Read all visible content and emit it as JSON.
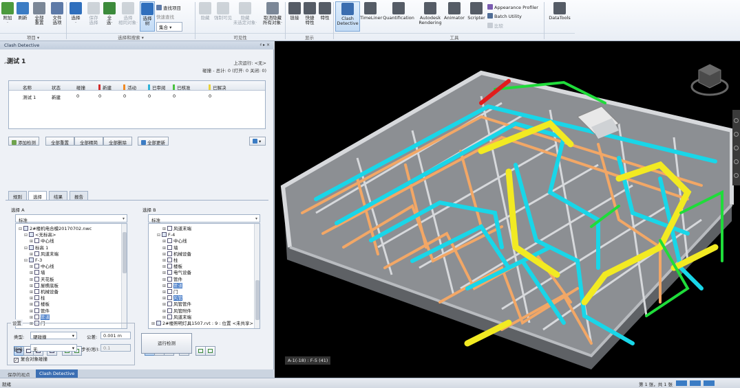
{
  "ribbon": {
    "buttons": [
      {
        "label": "附加\n·",
        "icon": "append-icon",
        "color": "#4c9a3e"
      },
      {
        "label": "刷新",
        "icon": "refresh-icon",
        "color": "#3b7cc4"
      },
      {
        "label": "全部\n重置",
        "icon": "reset-all-icon",
        "color": "#7b8797"
      },
      {
        "label": "文件\n选项",
        "icon": "file-options-icon",
        "color": "#5d7aa8"
      },
      {
        "label": "选择\n·",
        "icon": "select-cursor-icon",
        "color": "#2f6fbd"
      },
      {
        "label": "保存\n选择",
        "icon": "save-selection-icon",
        "color": "#9aa3ad"
      },
      {
        "label": "全\n选·",
        "icon": "select-all-icon",
        "color": "#3b8a3b"
      },
      {
        "label": "选择\n相同对象·",
        "icon": "select-same-icon",
        "color": "#9aa3ad"
      },
      {
        "label": "选择\n树",
        "icon": "selection-tree-icon",
        "color": "#2f6fbd"
      },
      {
        "label": "隐藏",
        "icon": "hide-icon",
        "color": "#9aa3ad"
      },
      {
        "label": "强制可见",
        "icon": "require-icon",
        "color": "#9aa3ad"
      },
      {
        "label": "隐藏\n未选定对象·",
        "icon": "hide-unselected-icon",
        "color": "#9aa3ad"
      },
      {
        "label": "取消隐藏\n所有对象·",
        "icon": "unhide-all-icon",
        "color": "#7b8797"
      },
      {
        "label": "链接",
        "icon": "links-icon",
        "color": "#555c66"
      },
      {
        "label": "快捷\n特性",
        "icon": "quick-properties-icon",
        "color": "#555c66"
      },
      {
        "label": "特性",
        "icon": "properties-icon",
        "color": "#555c66"
      },
      {
        "label": "Clash\nDetective",
        "icon": "clash-detective-icon",
        "color": "#3a6db0"
      },
      {
        "label": "TimeLiner",
        "icon": "timeliner-icon",
        "color": "#555c66"
      },
      {
        "label": "Quantification",
        "icon": "quantification-icon",
        "color": "#555c66"
      },
      {
        "label": "Autodesk\nRendering",
        "icon": "rendering-icon",
        "color": "#555c66"
      },
      {
        "label": "Animator",
        "icon": "animator-icon",
        "color": "#555c66"
      },
      {
        "label": "Scripter",
        "icon": "scripter-icon",
        "color": "#555c66"
      },
      {
        "label": "DataTools",
        "icon": "datatools-icon",
        "color": "#555c66"
      }
    ],
    "small": {
      "find_items": "查找项目",
      "quick_find": "快速查找",
      "same_level": "集合",
      "appearance_profiler": "Appearance Profiler",
      "batch_utility": "Batch Utility",
      "compare": "比较"
    },
    "groups": [
      "项目 ▾",
      "选择和搜索 ▾",
      "可见性",
      "显示",
      "工具"
    ]
  },
  "panel": {
    "title": "Clash Detective",
    "controls": "♯ ▸ ×",
    "test_name": "测试 1",
    "chevron": "︽",
    "last_run": "上次运行: <无>",
    "counts": "碰撞 - 总计: 0 (打开: 0  关闭: 0)",
    "table": {
      "headers": [
        {
          "label": "名称",
          "swatch": ""
        },
        {
          "label": "状态",
          "swatch": ""
        },
        {
          "label": "碰撞",
          "swatch": ""
        },
        {
          "label": "新建",
          "swatch": "#d22b2b"
        },
        {
          "label": "活动",
          "swatch": "#f08a24"
        },
        {
          "label": "已审阅",
          "swatch": "#2eb3d8"
        },
        {
          "label": "已核准",
          "swatch": "#49c23e"
        },
        {
          "label": "已解决",
          "swatch": "#e8d23a"
        }
      ],
      "rows": [
        [
          "测试 1",
          "新建",
          "0",
          "0",
          "0",
          "0",
          "0",
          "0"
        ]
      ]
    },
    "buttons": {
      "add_test": "添加检测",
      "reset_all": "全部重置",
      "compact_all": "全部精简",
      "delete_all": "全部删除",
      "update_all": "全部更新",
      "export": "▾"
    },
    "tabs": [
      "规则",
      "选择",
      "结果",
      "报告"
    ],
    "selection_a": {
      "label": "选择 A",
      "dropdown": "标准",
      "items": [
        {
          "text": "2#楼机电合模20170702.nwc",
          "depth": 0,
          "exp": "⊟",
          "hl": false
        },
        {
          "text": "<无标高>",
          "depth": 1,
          "exp": "⊟",
          "hl": false
        },
        {
          "text": "中心线",
          "depth": 2,
          "exp": "⊞",
          "hl": false
        },
        {
          "text": "标高 1",
          "depth": 1,
          "exp": "⊟",
          "hl": false
        },
        {
          "text": "风道末端",
          "depth": 2,
          "exp": "⊞",
          "hl": false
        },
        {
          "text": "F-3",
          "depth": 1,
          "exp": "⊟",
          "hl": false
        },
        {
          "text": "中心线",
          "depth": 2,
          "exp": "⊞",
          "hl": false
        },
        {
          "text": "墙",
          "depth": 2,
          "exp": "⊞",
          "hl": false
        },
        {
          "text": "天花板",
          "depth": 2,
          "exp": "⊞",
          "hl": false
        },
        {
          "text": "屋檐底板",
          "depth": 2,
          "exp": "⊞",
          "hl": false
        },
        {
          "text": "机械设备",
          "depth": 2,
          "exp": "⊞",
          "hl": false
        },
        {
          "text": "柱",
          "depth": 2,
          "exp": "⊞",
          "hl": false
        },
        {
          "text": "楼板",
          "depth": 2,
          "exp": "⊞",
          "hl": false
        },
        {
          "text": "管件",
          "depth": 2,
          "exp": "⊞",
          "hl": false
        },
        {
          "text": "管道",
          "depth": 2,
          "exp": "⊞",
          "hl": true
        },
        {
          "text": "门",
          "depth": 2,
          "exp": "⊞",
          "hl": false
        }
      ]
    },
    "selection_b": {
      "label": "选择 B",
      "dropdown": "标准",
      "items": [
        {
          "text": "风道末端",
          "depth": 2,
          "exp": "⊞",
          "hl": false
        },
        {
          "text": "F-4",
          "depth": 1,
          "exp": "⊟",
          "hl": false
        },
        {
          "text": "中心线",
          "depth": 2,
          "exp": "⊞",
          "hl": false
        },
        {
          "text": "墙",
          "depth": 2,
          "exp": "⊞",
          "hl": false
        },
        {
          "text": "机械设备",
          "depth": 2,
          "exp": "⊞",
          "hl": false
        },
        {
          "text": "柱",
          "depth": 2,
          "exp": "⊞",
          "hl": false
        },
        {
          "text": "楼板",
          "depth": 2,
          "exp": "⊞",
          "hl": false
        },
        {
          "text": "电气设备",
          "depth": 2,
          "exp": "⊞",
          "hl": false
        },
        {
          "text": "管件",
          "depth": 2,
          "exp": "⊞",
          "hl": false
        },
        {
          "text": "管道",
          "depth": 2,
          "exp": "⊞",
          "hl": true
        },
        {
          "text": "门",
          "depth": 2,
          "exp": "⊞",
          "hl": false
        },
        {
          "text": "风管",
          "depth": 2,
          "exp": "⊞",
          "hl": true
        },
        {
          "text": "风管管件",
          "depth": 2,
          "exp": "⊞",
          "hl": false
        },
        {
          "text": "风管附件",
          "depth": 2,
          "exp": "⊞",
          "hl": false
        },
        {
          "text": "风道末端",
          "depth": 2,
          "exp": "⊞",
          "hl": false
        },
        {
          "text": "2#楼照明灯具1507.rvt : 9 : 位置 <未共享>",
          "depth": 0,
          "exp": "⊞",
          "hl": false
        }
      ]
    },
    "settings": {
      "title": "设置",
      "type_label": "类型:",
      "type_value": "硬碰撞",
      "tolerance_label": "公差:",
      "tolerance_value": "0.001 m",
      "link_label": "链接:",
      "link_value": "无",
      "step_label": "步长(秒):",
      "step_value": "0.1",
      "composite_label": "复合对象碰撞",
      "composite_checked": "✓",
      "run_button": "运行检测"
    },
    "bottom_tabs": [
      "保存的视点",
      "Clash Detective"
    ]
  },
  "viewport": {
    "coordinates": "A-1(-18) : F-5 (41)",
    "colors": {
      "cyan": "#19d6e8",
      "yellow": "#f2ea22",
      "orange": "#f2a766",
      "green": "#1fdc3a",
      "red": "#e21c1c",
      "slab": "#8c8f93",
      "wall": "#d7d9dc"
    }
  },
  "status": {
    "left": "就绪",
    "page": "第 1 张，共 1 张"
  }
}
